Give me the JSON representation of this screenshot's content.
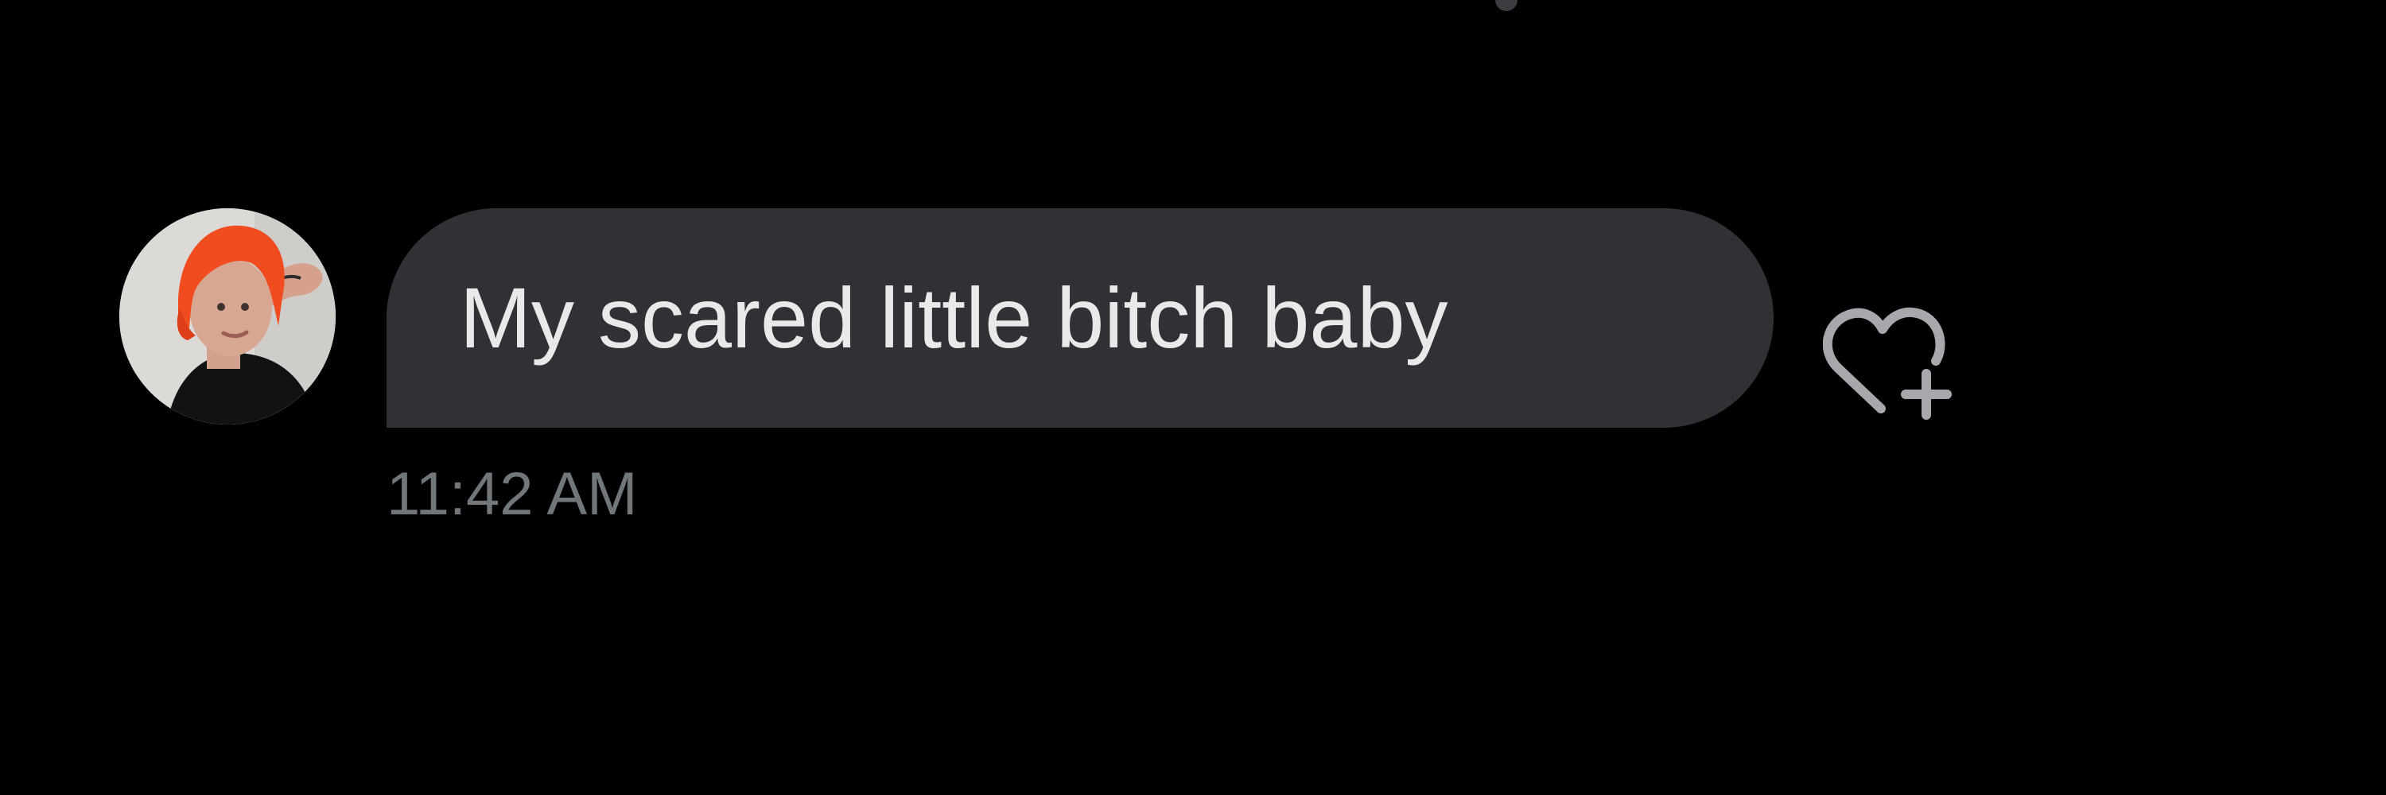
{
  "message": {
    "text": "My scared little bitch baby",
    "timestamp": "11:42 AM"
  },
  "icons": {
    "avatar": "user-avatar-photo",
    "reaction": "heart-plus-icon"
  },
  "colors": {
    "background": "#000000",
    "bubble": "#2f3134",
    "text": "#e7e9ea",
    "timestamp": "#71767b",
    "icon": "#a6a8ab"
  }
}
